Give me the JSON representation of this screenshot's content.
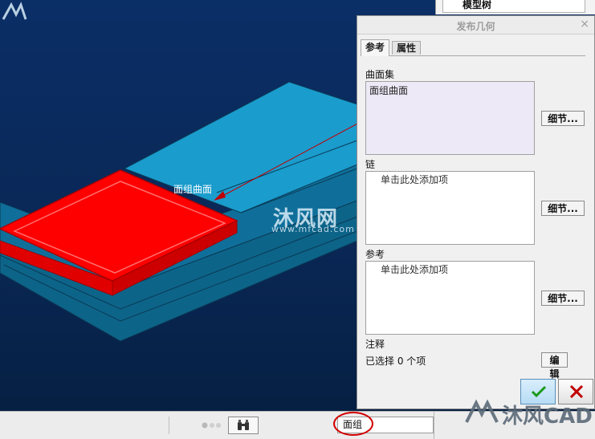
{
  "viewport": {
    "surface_label": "面组曲面",
    "watermark_brand": "沐风网",
    "watermark_url": "www.mfcad.com",
    "highlight_color": "#ff0000",
    "model_color": "#1a9ccd"
  },
  "model_tree": {
    "title": "模型树"
  },
  "dialog": {
    "title": "发布几何",
    "close_glyph": "×",
    "tabs": [
      {
        "label": "参考"
      },
      {
        "label": "属性"
      }
    ],
    "sections": {
      "surface_set": {
        "label": "曲面集",
        "entry": "面组曲面",
        "detail_label": "细节..."
      },
      "chain": {
        "label": "链",
        "hint": "单击此处添加项",
        "detail_label": "细节..."
      },
      "reference": {
        "label": "参考",
        "hint": "单击此处添加项",
        "detail_label": "细节..."
      },
      "note": {
        "label": "注释",
        "selected_text": "已选择 0 个项",
        "edit_label": "编辑"
      }
    },
    "ok_color": "#1a9a1a",
    "cancel_color": "#c00000"
  },
  "statusbar": {
    "filter_value": "面组",
    "circle_color": "#d20000"
  },
  "brand_bottom": {
    "text": "沐风CAD"
  }
}
